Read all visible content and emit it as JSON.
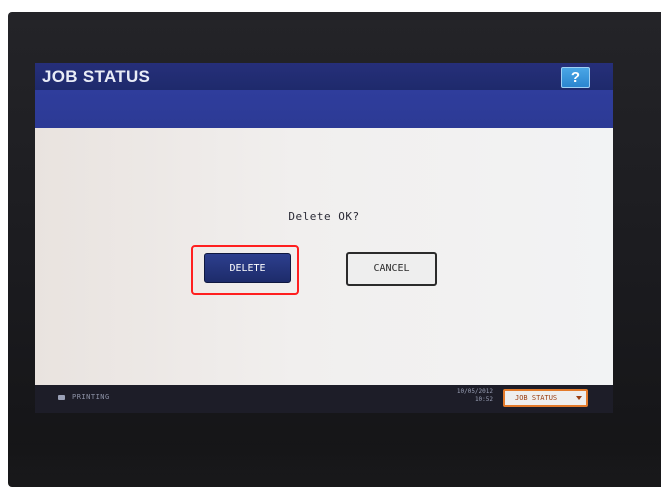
{
  "header": {
    "title": "JOB STATUS",
    "help_label": "?"
  },
  "dialog": {
    "message": "Delete OK?",
    "delete_label": "DELETE",
    "cancel_label": "CANCEL"
  },
  "status_bar": {
    "status_text": "PRINTING",
    "date": "10/05/2012",
    "time": "10:52",
    "job_status_label": "JOB STATUS"
  },
  "colors": {
    "title_bar": "#1e2a6c",
    "band": "#2c3a95",
    "delete_button": "#2d3f8e",
    "highlight": "#ff1f1f",
    "job_status_border": "#e37a2a"
  },
  "icons": {
    "status": "printer-icon",
    "job_status_arrow": "chevron-down-icon"
  }
}
